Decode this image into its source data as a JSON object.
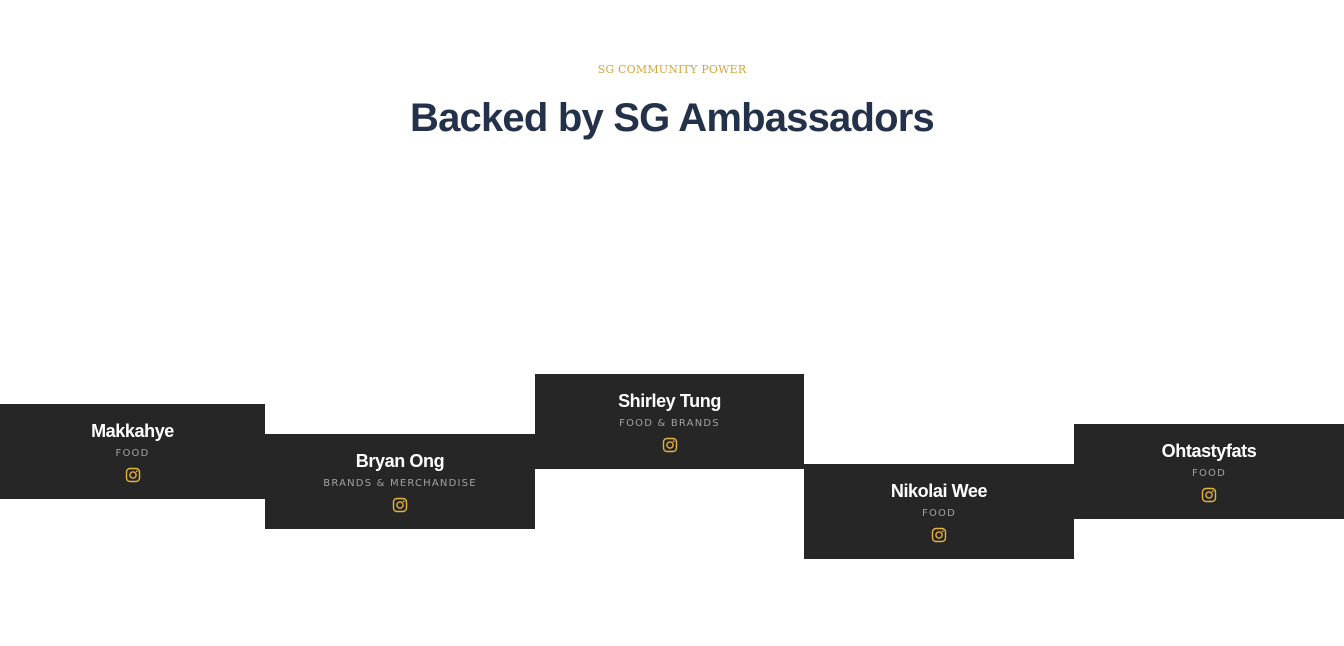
{
  "section": {
    "eyebrow": "SG COMMUNITY POWER",
    "title": "Backed by SG Ambassadors"
  },
  "colors": {
    "accent": "#d3a63a",
    "heading": "#23324a",
    "card_bg": "#262626",
    "card_name": "#ffffff",
    "card_category": "#a2a2a2",
    "icon": "#e8b13a"
  },
  "ambassadors": [
    {
      "name": "Makkahye",
      "category": "FOOD",
      "icon": "instagram-icon"
    },
    {
      "name": "Bryan Ong",
      "category": "BRANDS & MERCHANDISE",
      "icon": "instagram-icon"
    },
    {
      "name": "Shirley Tung",
      "category": "FOOD & BRANDS",
      "icon": "instagram-icon"
    },
    {
      "name": "Nikolai Wee",
      "category": "FOOD",
      "icon": "instagram-icon"
    },
    {
      "name": "Ohtastyfats",
      "category": "FOOD",
      "icon": "instagram-icon"
    }
  ]
}
